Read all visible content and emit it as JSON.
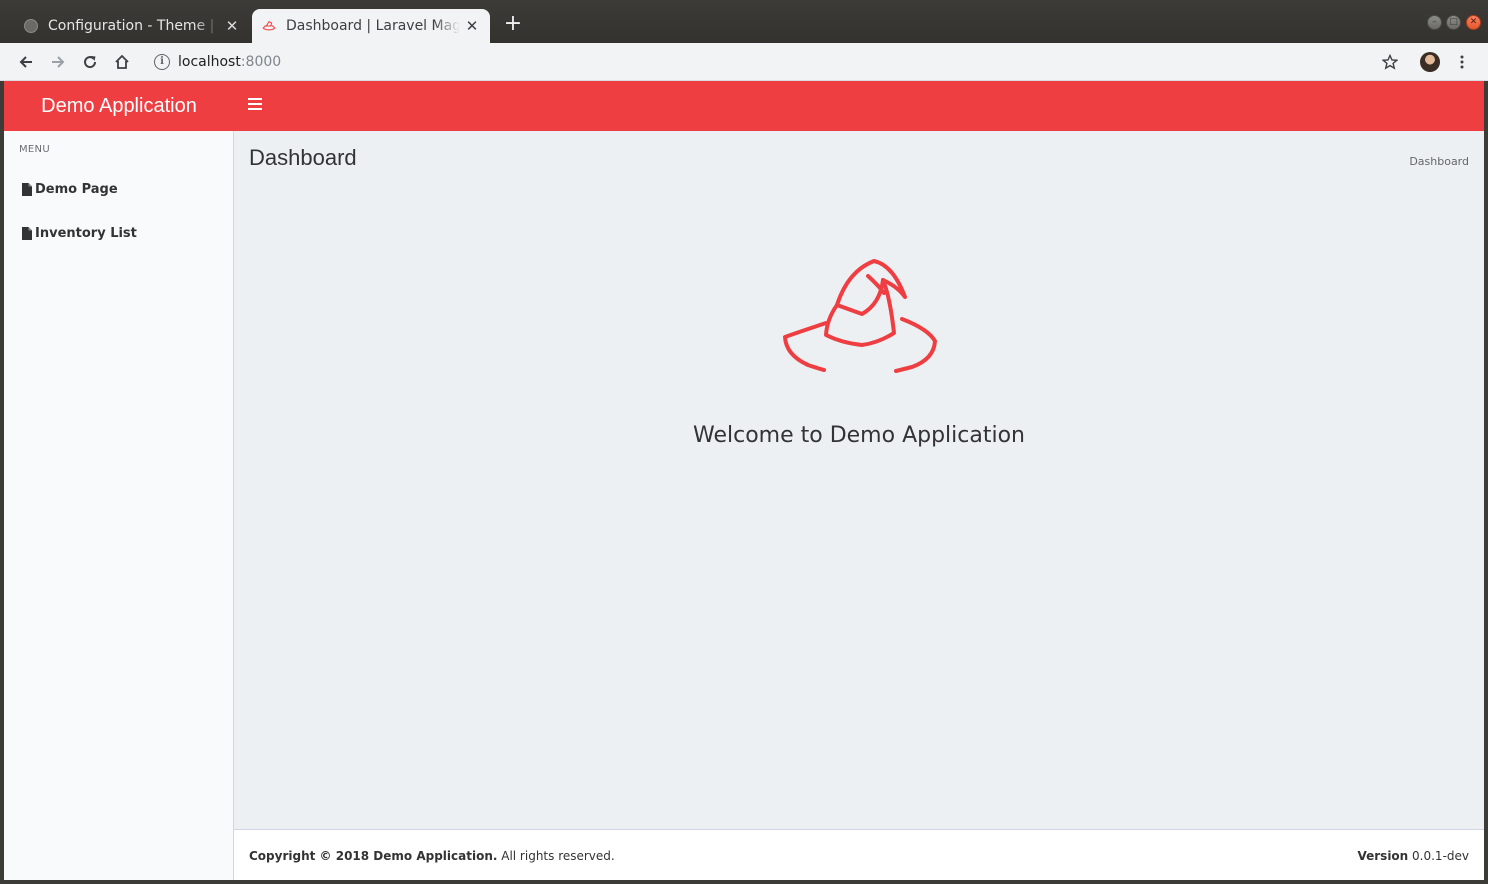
{
  "browser": {
    "tabs": [
      {
        "title": "Configuration - Theme | Laravel Mage",
        "close": "✕"
      },
      {
        "title": "Dashboard | Laravel Mage",
        "close": "✕"
      }
    ],
    "new_tab": "+",
    "url_host": "localhost",
    "url_port": ":8000"
  },
  "app": {
    "brand": "Demo Application",
    "sidebar": {
      "header": "MENU",
      "items": [
        {
          "label": "Demo Page"
        },
        {
          "label": "Inventory List"
        }
      ]
    },
    "page_title": "Dashboard",
    "breadcrumb": "Dashboard",
    "welcome": "Welcome to Demo Application",
    "footer": {
      "copyright_bold": "Copyright © 2018 Demo Application.",
      "copyright_rest": " All rights reserved.",
      "version_label": "Version",
      "version_value": " 0.0.1-dev"
    }
  },
  "colors": {
    "accent": "#ef3e42",
    "sidebar_bg": "#f9fafc",
    "content_bg": "#ecf0f3"
  },
  "icons": [
    "globe-icon",
    "hat-icon",
    "close-icon",
    "plus-icon",
    "back-icon",
    "forward-icon",
    "reload-icon",
    "home-icon",
    "info-icon",
    "star-icon",
    "menu-dots-icon",
    "hamburger-icon",
    "document-icon"
  ]
}
